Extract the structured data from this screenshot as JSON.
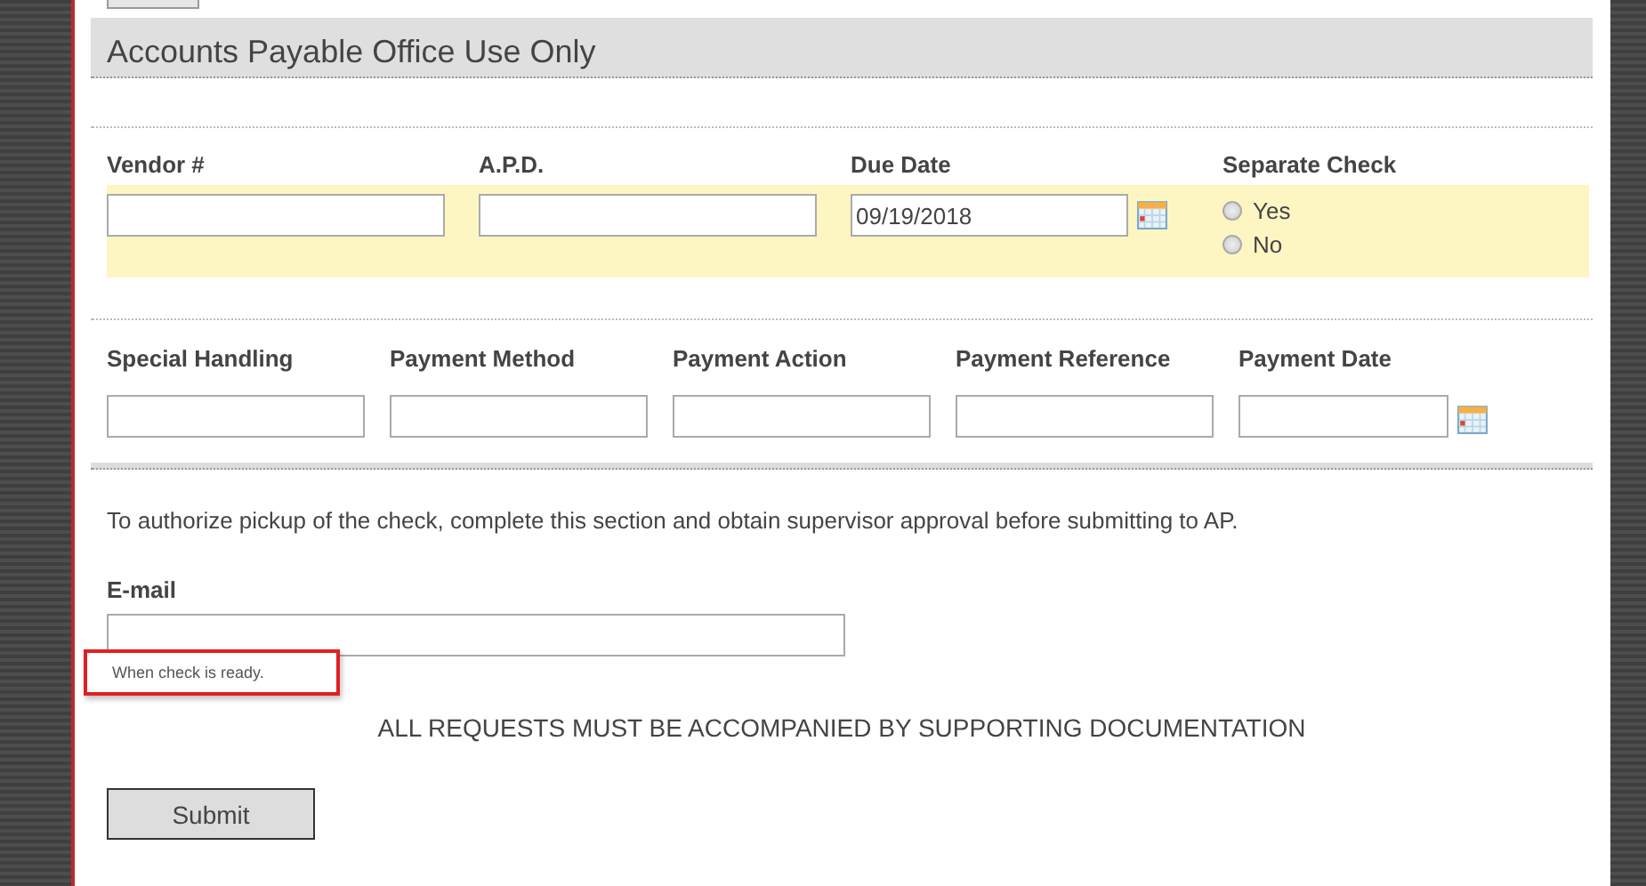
{
  "section": {
    "title": "Accounts Payable Office Use Only"
  },
  "row_1": [
    {
      "kind": "text",
      "label": "Vendor #"
    },
    {
      "kind": "text",
      "label": "A.P.D."
    },
    {
      "kind": "date",
      "label": "Due Date",
      "value": "09/19/2018"
    },
    {
      "kind": "radio",
      "label": "Separate Check",
      "options": [
        {
          "label": "Yes",
          "selected": false
        },
        {
          "label": "No",
          "selected": false
        }
      ]
    }
  ],
  "row_2": [
    {
      "kind": "text",
      "label": "Special Handling"
    },
    {
      "kind": "text",
      "label": "Payment Method"
    },
    {
      "kind": "text",
      "label": "Payment Action"
    },
    {
      "kind": "text",
      "label": "Payment Reference"
    },
    {
      "kind": "date",
      "label": "Payment Date"
    }
  ],
  "pickup_note": "To authorize pickup of the check, complete this section and obtain supervisor approval before submitting to AP.",
  "email": {
    "label": "E-mail",
    "hint": "When check is ready."
  },
  "notice": "ALL REQUESTS MUST BE ACCOMPANIED BY SUPPORTING DOCUMENTATION",
  "submit_button": "Submit"
}
